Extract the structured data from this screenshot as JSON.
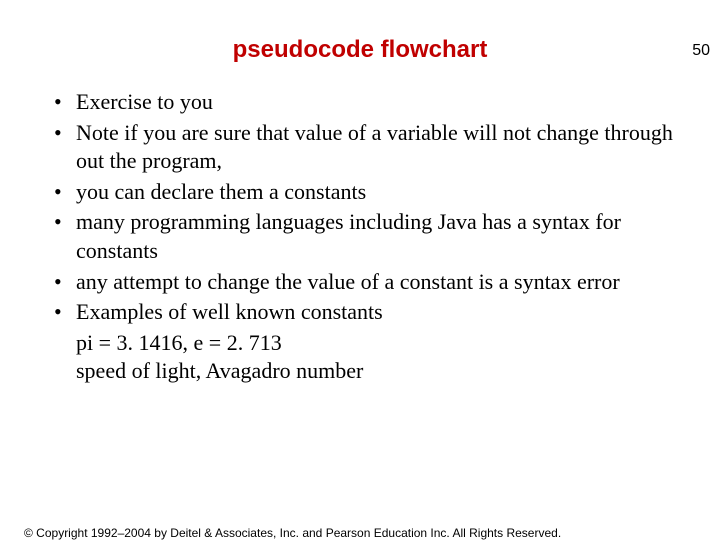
{
  "page_number": "50",
  "title": "pseudocode flowchart",
  "bullets": [
    "Exercise to you",
    "Note if you are sure that value of a variable will not change through out the program,",
    "you can declare them a constants",
    "many programming languages including Java has a syntax for constants",
    "any attempt to change the value of a constant is a syntax error",
    "Examples of well known constants"
  ],
  "sub_lines": [
    "pi = 3. 1416, e = 2. 713",
    "speed of light, Avagadro number"
  ],
  "copyright": "© Copyright 1992–2004 by Deitel & Associates, Inc. and Pearson Education Inc. All Rights Reserved."
}
